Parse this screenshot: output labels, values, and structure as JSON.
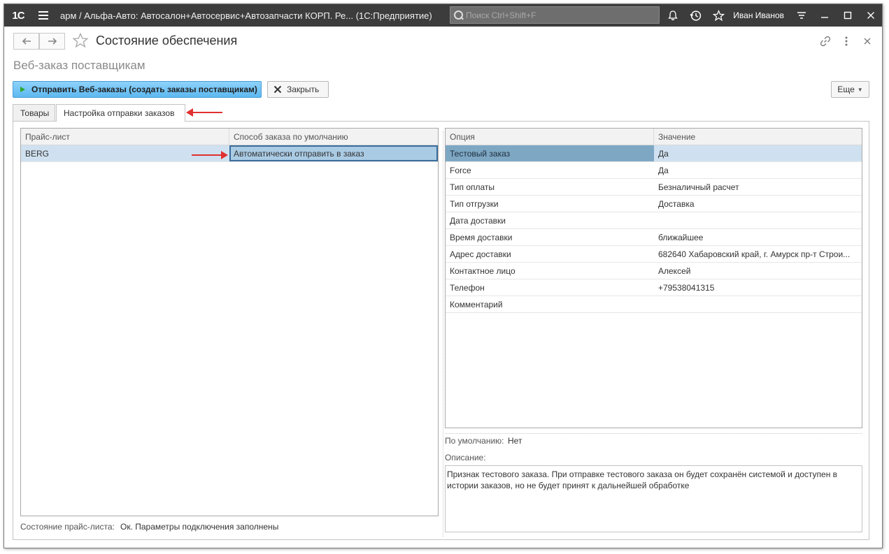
{
  "titlebar": {
    "logo": "1С",
    "app_title": "арм / Альфа-Авто: Автосалон+Автосервис+Автозапчасти КОРП. Ре...   (1С:Предприятие)",
    "search_placeholder": "Поиск Ctrl+Shift+F",
    "user_name": "Иван Иванов"
  },
  "header": {
    "title": "Состояние обеспечения",
    "subtitle": "Веб-заказ поставщикам"
  },
  "toolbar": {
    "send_label": "Отправить Веб-заказы (создать заказы поставщикам)",
    "close_label": "Закрыть",
    "more_label": "Еще"
  },
  "tabs": [
    {
      "label": "Товары"
    },
    {
      "label": "Настройка отправки заказов"
    }
  ],
  "price_table": {
    "columns": [
      "Прайс-лист",
      "Способ заказа по умолчанию"
    ],
    "rows": [
      {
        "price_list": "BERG",
        "method": "Автоматически отправить в заказ"
      }
    ]
  },
  "options_table": {
    "columns": [
      "Опция",
      "Значение"
    ],
    "rows": [
      {
        "option": "Тестовый заказ",
        "value": "Да"
      },
      {
        "option": "Force",
        "value": "Да"
      },
      {
        "option": "Тип оплаты",
        "value": "Безналичный расчет"
      },
      {
        "option": "Тип отгрузки",
        "value": "Доставка"
      },
      {
        "option": "Дата доставки",
        "value": ""
      },
      {
        "option": "Время доставки",
        "value": "ближайшее"
      },
      {
        "option": "Адрес доставки",
        "value": "682640 Хабаровский край, г. Амурск пр-т Строи..."
      },
      {
        "option": "Контактное лицо",
        "value": "Алексей"
      },
      {
        "option": "Телефон",
        "value": "+79538041315"
      },
      {
        "option": "Комментарий",
        "value": ""
      }
    ]
  },
  "details": {
    "default_label": "По умолчанию:",
    "default_value": "Нет",
    "description_label": "Описание:",
    "description_text": "Признак тестового заказа. При отправке тестового заказа он будет сохранён системой и доступен в истории заказов, но не будет принят к дальнейшей обработке"
  },
  "status": {
    "label": "Состояние прайс-листа:",
    "value": "Ок. Параметры подключения заполнены"
  },
  "colors": {
    "titlebar_bg": "#3c3c3c",
    "primary_button": "#5cb8f0",
    "selection": "#cfe1f0",
    "annotation_arrow": "#e03030"
  }
}
